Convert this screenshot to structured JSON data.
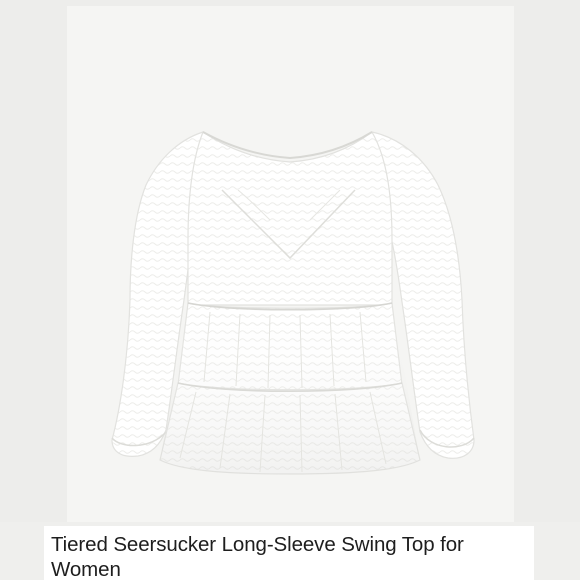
{
  "product": {
    "title": "Tiered Seersucker Long-Sleeve Swing Top for Women",
    "image_subject": "white-tiered-blouse"
  },
  "colors": {
    "background": "#efefed",
    "photo_backdrop": "#f5f5f3",
    "garment": "#ffffff",
    "caption_background": "#ffffff",
    "caption_text": "#1e1e1e"
  }
}
